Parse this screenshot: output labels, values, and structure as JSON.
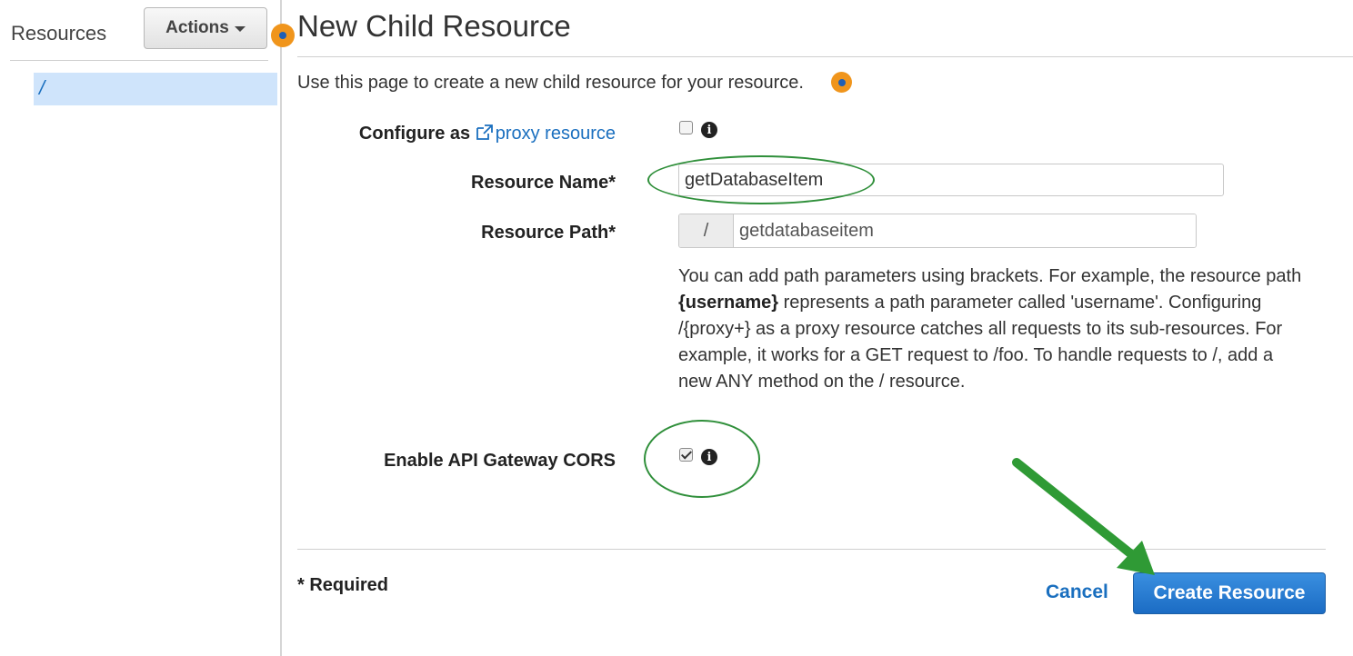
{
  "sidebar": {
    "title": "Resources",
    "actions_label": "Actions",
    "resources": [
      "/"
    ]
  },
  "main": {
    "title": "New Child Resource",
    "intro": "Use this page to create a new child resource for your resource.",
    "configure_label": "Configure as",
    "proxy_link": "proxy resource",
    "proxy_checked": false,
    "resource_name_label": "Resource Name*",
    "resource_name_value": "getDatabaseItem",
    "resource_path_label": "Resource Path*",
    "resource_path_prefix": "/",
    "resource_path_value": "getdatabaseitem",
    "help_part1": "You can add path parameters using brackets. For example, the resource path ",
    "help_bold": "{username}",
    "help_part2": " represents a path parameter called 'username'. Configuring /{proxy+} as a proxy resource catches all requests to its sub-resources. For example, it works for a GET request to /foo. To handle requests to /, add a new ANY method on the / resource.",
    "cors_label": "Enable API Gateway CORS",
    "cors_checked": true
  },
  "footer": {
    "required_note": "* Required",
    "cancel_label": "Cancel",
    "create_label": "Create Resource"
  },
  "colors": {
    "accent_blue": "#1a6fbf",
    "annotation_green": "#2f8f3a",
    "marker_orange": "#f0951c",
    "selected_bg": "#cfe4fb"
  }
}
